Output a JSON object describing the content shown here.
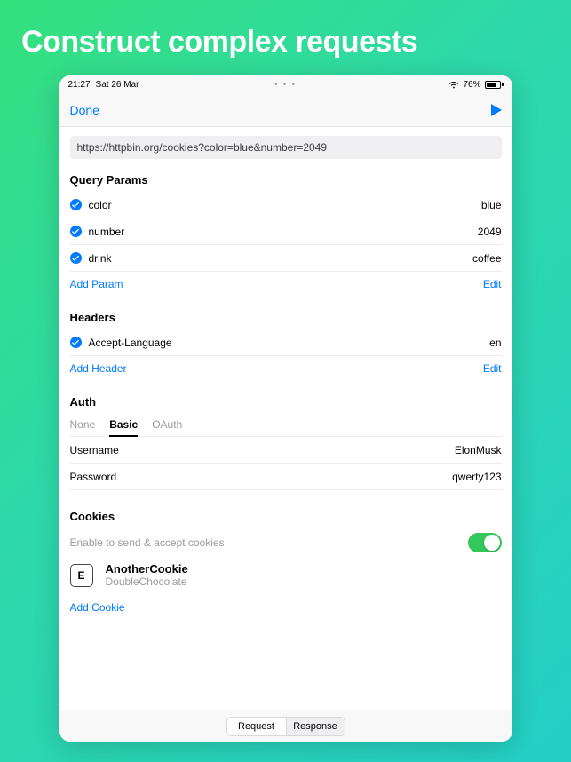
{
  "marketing": {
    "headline": "Construct complex requests"
  },
  "statusbar": {
    "time": "21:27",
    "date": "Sat 26 Mar",
    "battery_pct": "76%"
  },
  "navbar": {
    "done": "Done"
  },
  "url": "https://httpbin.org/cookies?color=blue&number=2049",
  "queryParams": {
    "title": "Query Params",
    "items": [
      {
        "key": "color",
        "value": "blue"
      },
      {
        "key": "number",
        "value": "2049"
      },
      {
        "key": "drink",
        "value": "coffee"
      }
    ],
    "addLabel": "Add Param",
    "editLabel": "Edit"
  },
  "headers": {
    "title": "Headers",
    "items": [
      {
        "key": "Accept-Language",
        "value": "en"
      }
    ],
    "addLabel": "Add Header",
    "editLabel": "Edit"
  },
  "auth": {
    "title": "Auth",
    "tabs": {
      "none": "None",
      "basic": "Basic",
      "oauth": "OAuth"
    },
    "usernameLabel": "Username",
    "usernameValue": "ElonMusk",
    "passwordLabel": "Password",
    "passwordValue": "qwerty123"
  },
  "cookies": {
    "title": "Cookies",
    "enableText": "Enable to send & accept cookies",
    "item": {
      "iconLetter": "E",
      "name": "AnotherCookie",
      "value": "DoubleChocolate"
    },
    "addLabel": "Add Cookie"
  },
  "bottomTabs": {
    "request": "Request",
    "response": "Response"
  }
}
